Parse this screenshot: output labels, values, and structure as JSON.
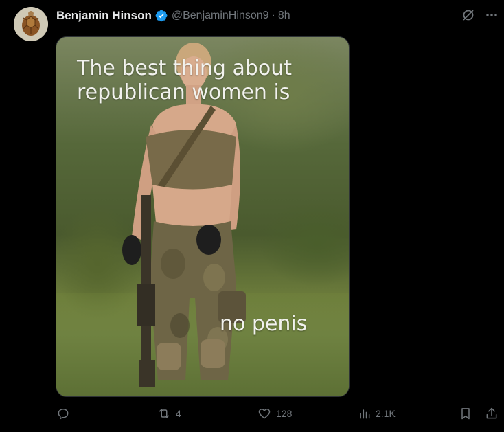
{
  "author": {
    "display_name": "Benjamin Hinson",
    "handle": "@BenjaminHinson9",
    "separator": "·",
    "time": "8h",
    "verified": true,
    "avatar_icon": "turtle-avatar"
  },
  "top_actions": {
    "grok_icon": "grok-icon",
    "more_icon": "more-icon"
  },
  "media": {
    "caption_top": "The best thing about republican women is",
    "caption_bottom": "no penis"
  },
  "actions": {
    "reply": {
      "icon": "reply-icon",
      "count": ""
    },
    "repost": {
      "icon": "repost-icon",
      "count": "4"
    },
    "like": {
      "icon": "heart-icon",
      "count": "128"
    },
    "views": {
      "icon": "views-icon",
      "count": "2.1K"
    },
    "bookmark": {
      "icon": "bookmark-icon"
    },
    "share": {
      "icon": "share-icon"
    }
  },
  "colors": {
    "background": "#000000",
    "text_primary": "#e7e9ea",
    "text_secondary": "#71767b",
    "verified_badge": "#1d9bf0"
  }
}
